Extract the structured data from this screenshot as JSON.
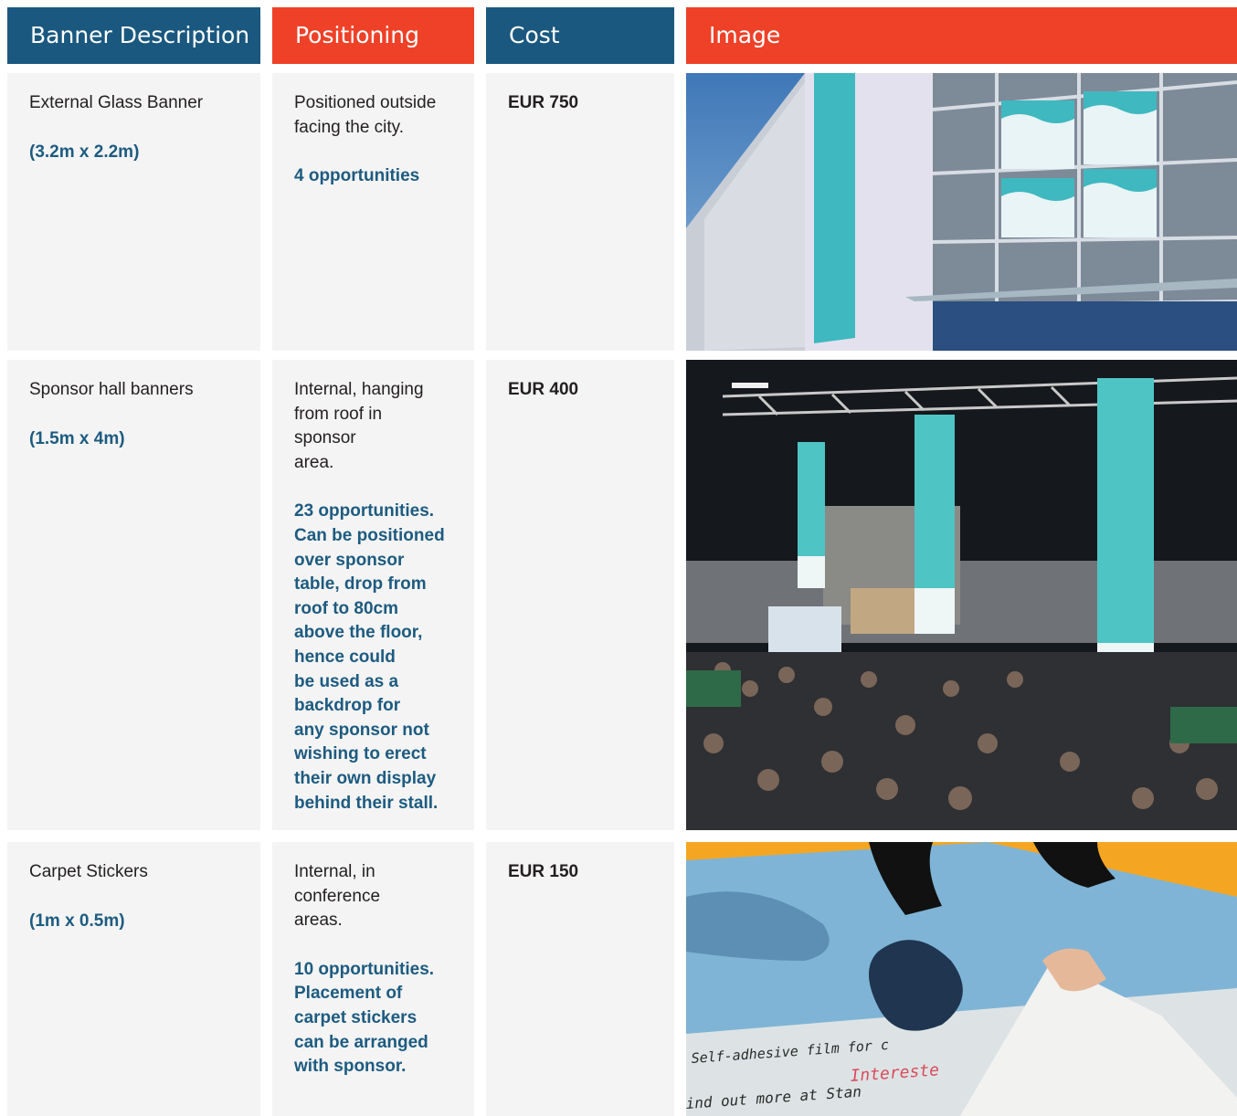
{
  "headers": {
    "description": "Banner Description",
    "positioning": "Positioning",
    "cost": "Cost",
    "image": "Image"
  },
  "rows": [
    {
      "title": "External Glass Banner",
      "size": "(3.2m x 2.2m)",
      "position_lines": [
        "Positioned outside",
        "facing the city."
      ],
      "opportunities_lines": [
        "4 opportunities"
      ],
      "cost": "EUR 750",
      "image_icon": "building-exterior-photo"
    },
    {
      "title": "Sponsor hall banners",
      "size": "(1.5m x 4m)",
      "position_lines": [
        "Internal, hanging",
        "from  roof in",
        "sponsor",
        "area."
      ],
      "opportunities_lines": [
        "23 opportunities.",
        "Can be positioned",
        "over sponsor",
        "table, drop from",
        "roof to 80cm",
        "above the floor,",
        "hence could",
        "be used as a",
        "backdrop for",
        "any sponsor not",
        "wishing to erect",
        "their own display",
        "behind their stall."
      ],
      "cost": "EUR 400",
      "image_icon": "sponsor-hall-photo"
    },
    {
      "title": "Carpet Stickers",
      "size": "(1m x 0.5m)",
      "position_lines": [
        "Internal, in",
        "conference",
        "areas."
      ],
      "opportunities_lines": [
        "10 opportunities.",
        "Placement of",
        "carpet stickers",
        "can be arranged",
        "with sponsor."
      ],
      "cost": "EUR 150",
      "image_icon": "carpet-sticker-photo",
      "image_text": [
        "Self-adhesive film for c",
        "Intereste",
        "ind out more at Stan"
      ]
    }
  ],
  "colors": {
    "header_blue": "#1a587f",
    "header_orange": "#ee4128",
    "accent_text": "#1d5b80",
    "cell_bg": "#f4f4f4"
  }
}
